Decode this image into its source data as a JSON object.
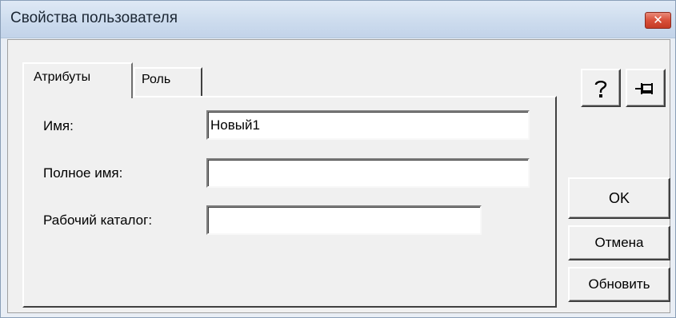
{
  "window": {
    "title": "Свойства пользователя",
    "close_glyph": "✕"
  },
  "tabs": [
    {
      "label": "Атрибуты",
      "selected": true
    },
    {
      "label": "Роль",
      "selected": false
    }
  ],
  "fields": {
    "name": {
      "label": "Имя:",
      "value": "Новый1"
    },
    "full_name": {
      "label": "Полное имя:",
      "value": ""
    },
    "work_dir": {
      "label": "Рабочий каталог:",
      "value": ""
    }
  },
  "buttons": {
    "browse": "...",
    "ok": "OK",
    "cancel": "Отмена",
    "refresh": "Обновить",
    "help_icon": "question-icon",
    "pin_icon": "pin-icon"
  },
  "colors": {
    "titlebar": "#cddcee",
    "close_button": "#d9503a",
    "dialog_face": "#f0f0f0"
  }
}
